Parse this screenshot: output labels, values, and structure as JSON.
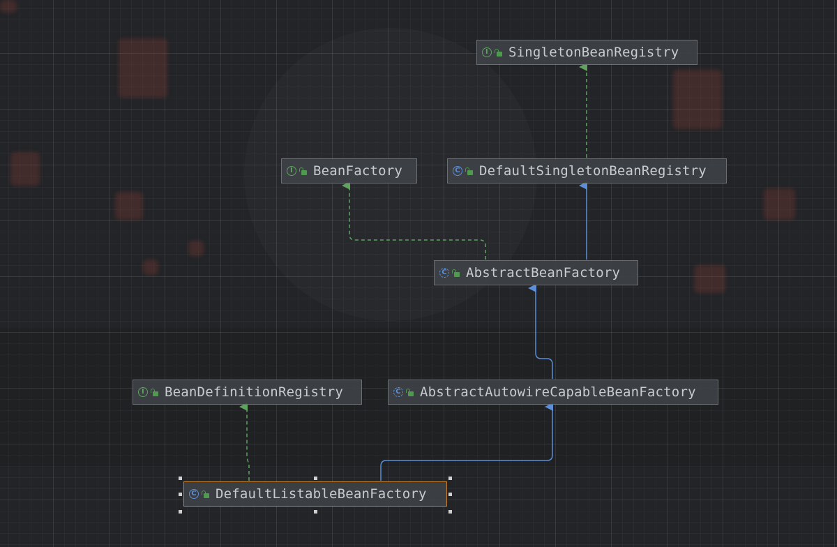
{
  "diagram": {
    "nodes": [
      {
        "id": "singleton-bean-registry",
        "kind": "interface",
        "kind_glyph": "I",
        "label": "SingletonBeanRegistry"
      },
      {
        "id": "bean-factory",
        "kind": "interface",
        "kind_glyph": "I",
        "label": "BeanFactory"
      },
      {
        "id": "default-singleton-bean-registry",
        "kind": "class",
        "kind_glyph": "C",
        "label": "DefaultSingletonBeanRegistry"
      },
      {
        "id": "abstract-bean-factory",
        "kind": "abstract-class",
        "kind_glyph": "C",
        "label": "AbstractBeanFactory"
      },
      {
        "id": "bean-definition-registry",
        "kind": "interface",
        "kind_glyph": "I",
        "label": "BeanDefinitionRegistry"
      },
      {
        "id": "abstract-autowire-capable-bean-factory",
        "kind": "abstract-class",
        "kind_glyph": "C",
        "label": "AbstractAutowireCapableBeanFactory"
      },
      {
        "id": "default-listable-bean-factory",
        "kind": "class",
        "kind_glyph": "C",
        "label": "DefaultListableBeanFactory",
        "selected": true
      }
    ],
    "edges": [
      {
        "from": "default-singleton-bean-registry",
        "to": "singleton-bean-registry",
        "type": "implements"
      },
      {
        "from": "abstract-bean-factory",
        "to": "bean-factory",
        "type": "implements"
      },
      {
        "from": "abstract-bean-factory",
        "to": "default-singleton-bean-registry",
        "type": "extends"
      },
      {
        "from": "abstract-autowire-capable-bean-factory",
        "to": "abstract-bean-factory",
        "type": "extends"
      },
      {
        "from": "default-listable-bean-factory",
        "to": "bean-definition-registry",
        "type": "implements"
      },
      {
        "from": "default-listable-bean-factory",
        "to": "abstract-autowire-capable-bean-factory",
        "type": "extends"
      }
    ],
    "colors": {
      "implements_edge": "#5fa35f",
      "extends_edge": "#5d8ed8",
      "selection_border": "#c7812d",
      "node_fill": "#3e4145",
      "node_text": "#c8cbcf"
    }
  }
}
